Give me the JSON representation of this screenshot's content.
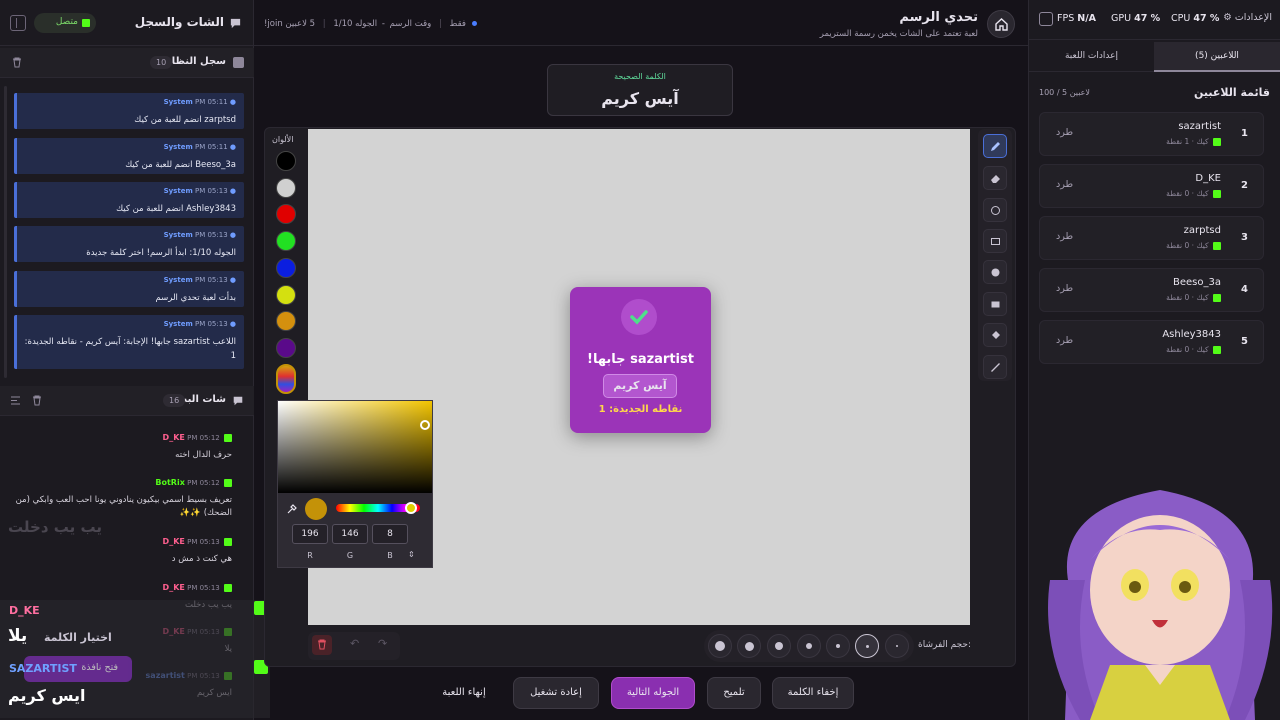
{
  "left": {
    "title": "الشات والسجل",
    "status": "متصل",
    "system_log": {
      "title": "سجل النظام",
      "count": "10"
    },
    "system_messages": [
      {
        "time": "PM 05:11",
        "sender": "System",
        "text": "zarptsd انضم للعبة من كيك"
      },
      {
        "time": "PM 05:11",
        "sender": "System",
        "text": "Beeso_3a انضم للعبة من كيك"
      },
      {
        "time": "PM 05:13",
        "sender": "System",
        "text": "Ashley3843 انضم للعبة من كيك"
      },
      {
        "time": "PM 05:13",
        "sender": "System",
        "text": "الجوله 1/10: ابدأ الرسم! اختر كلمة جديدة"
      },
      {
        "time": "PM 05:13",
        "sender": "System",
        "text": "بدأت لعبة تحدي الرسم"
      },
      {
        "time": "PM 05:13",
        "sender": "System",
        "text": "اللاعب sazartist جابها! الإجابة: آيس كريم - نقاطه الجديدة: 1"
      }
    ],
    "stream_chat": {
      "title": "شات البث",
      "count": "16"
    },
    "chat_messages": [
      {
        "time": "PM 05:12",
        "user": "D_KE",
        "color": "#ff5f8f",
        "text": "حرف الدال اخته"
      },
      {
        "time": "PM 05:12",
        "user": "BotRix",
        "color": "#53fc18",
        "text": "تعريف بسيط اسمي بيكيون ينادوني يونا احب العب وابكي (من الضحك) ✨✨"
      },
      {
        "time": "PM 05:13",
        "user": "D_KE",
        "color": "#ff5f8f",
        "text": "هي كنت ذ مش د"
      },
      {
        "time": "PM 05:13",
        "user": "D_KE",
        "color": "#ff5f8f",
        "text": "يب يب دخلت"
      },
      {
        "time": "PM 05:13",
        "user": "D_KE",
        "color": "#ff5f8f",
        "text": "يلا"
      },
      {
        "time": "PM 05:13",
        "user": "sazartist",
        "color": "#6f9cff",
        "text": "ايس كريم"
      }
    ],
    "overlay": {
      "ghost_text": "يب يب دخلت",
      "user1": "D_KE",
      "msg1": "يلا",
      "user2": "SAZARTIST",
      "msg2": "ايس كريم",
      "choose_word": "اختيار الكلمة",
      "open_window": "فتح نافذة"
    }
  },
  "topbar": {
    "game_title": "تحدي الرسم",
    "game_subtitle": "لعبة تعتمد على الشات يخمن رسمة الستريمر",
    "players_count": "5 لاعبين",
    "round": "الجوله 1/10",
    "phase": "وقت الرسم",
    "join_hint": "!join فقط"
  },
  "stats": {
    "fps_label": "FPS",
    "fps_value": "N/A",
    "gpu_label": "GPU",
    "gpu_value": "47 %",
    "cpu_label": "CPU",
    "cpu_value": "47 %",
    "settings_label": "الإعدادات"
  },
  "word_box": {
    "label": "الكلمة الصحيحة",
    "word": "آيس كريم"
  },
  "palette": {
    "title": "الألوان",
    "colors": [
      "#000000",
      "#d0d0d0",
      "#e00000",
      "#22e022",
      "#0b1ee0",
      "#d4e010",
      "#d4900e",
      "#5a0a8a"
    ]
  },
  "picker": {
    "r": "196",
    "g": "146",
    "b": "8",
    "r_label": "R",
    "g_label": "G",
    "b_label": "B",
    "current": "#c49208"
  },
  "winner": {
    "title": "sazartist جابها!",
    "word": "آيس كريم",
    "points": "نقاطه الجديدة: 1"
  },
  "brush": {
    "label": "حجم الفرشاة:"
  },
  "buttons": {
    "hide_word": "إخفاء الكلمة",
    "hint": "تلميح",
    "next_round": "الجوله التالية",
    "restart": "إعادة تشغيل",
    "end_game": "إنهاء اللعبة"
  },
  "right": {
    "tab_players": "اللاعبين (5)",
    "tab_settings": "إعدادات اللعبة",
    "list_title": "قائمة اللاعبين",
    "list_count": "100 / 5 لاعبين",
    "kick_label": "طرد",
    "players": [
      {
        "rank": "1",
        "name": "sazartist",
        "platform": "كيك",
        "points": "1 نقطة"
      },
      {
        "rank": "2",
        "name": "D_KE",
        "platform": "كيك",
        "points": "0 نقطة"
      },
      {
        "rank": "3",
        "name": "zarptsd",
        "platform": "كيك",
        "points": "0 نقطة"
      },
      {
        "rank": "4",
        "name": "Beeso_3a",
        "platform": "كيك",
        "points": "0 نقطة"
      },
      {
        "rank": "5",
        "name": "Ashley3843",
        "platform": "كيك",
        "points": "0 نقطة"
      }
    ]
  }
}
